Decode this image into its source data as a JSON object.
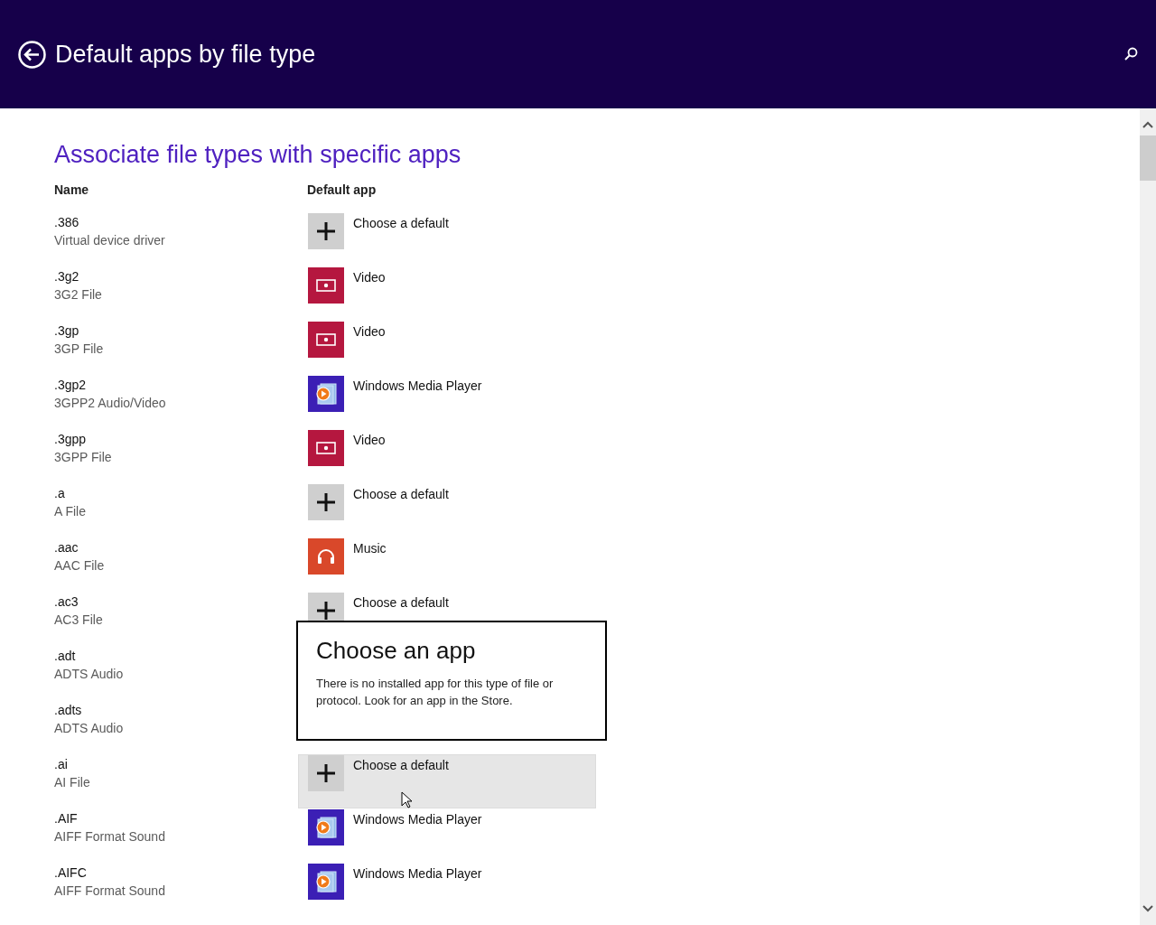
{
  "header": {
    "title": "Default apps by file type"
  },
  "page": {
    "heading": "Associate file types with specific apps",
    "columns": [
      "Name",
      "Default app"
    ]
  },
  "rows": [
    {
      "extension": ".386",
      "description": "Virtual device driver",
      "app": {
        "kind": "choose",
        "label": "Choose a default",
        "highlighted": false
      }
    },
    {
      "extension": ".3g2",
      "description": "3G2 File",
      "app": {
        "kind": "video",
        "label": "Video",
        "highlighted": false
      }
    },
    {
      "extension": ".3gp",
      "description": "3GP File",
      "app": {
        "kind": "video",
        "label": "Video",
        "highlighted": false
      }
    },
    {
      "extension": ".3gp2",
      "description": "3GPP2 Audio/Video",
      "app": {
        "kind": "wmp",
        "label": "Windows Media Player",
        "highlighted": false
      }
    },
    {
      "extension": ".3gpp",
      "description": "3GPP File",
      "app": {
        "kind": "video",
        "label": "Video",
        "highlighted": false
      }
    },
    {
      "extension": ".a",
      "description": "A File",
      "app": {
        "kind": "choose",
        "label": "Choose a default",
        "highlighted": false
      }
    },
    {
      "extension": ".aac",
      "description": "AAC File",
      "app": {
        "kind": "music",
        "label": "Music",
        "highlighted": false
      }
    },
    {
      "extension": ".ac3",
      "description": "AC3 File",
      "app": {
        "kind": "choose",
        "label": "Choose a default",
        "highlighted": false
      }
    },
    {
      "extension": ".adt",
      "description": "ADTS Audio"
    },
    {
      "extension": ".adts",
      "description": "ADTS Audio"
    },
    {
      "extension": ".ai",
      "description": "AI File",
      "app": {
        "kind": "choose",
        "label": "Choose a default",
        "highlighted": true
      }
    },
    {
      "extension": ".AIF",
      "description": "AIFF Format Sound",
      "app": {
        "kind": "wmp",
        "label": "Windows Media Player",
        "highlighted": false
      }
    },
    {
      "extension": ".AIFC",
      "description": "AIFF Format Sound",
      "app": {
        "kind": "wmp",
        "label": "Windows Media Player",
        "highlighted": false
      }
    }
  ],
  "popup": {
    "title": "Choose an app",
    "message": "There is no installed app for this type of file or protocol. Look for an app in the Store."
  }
}
